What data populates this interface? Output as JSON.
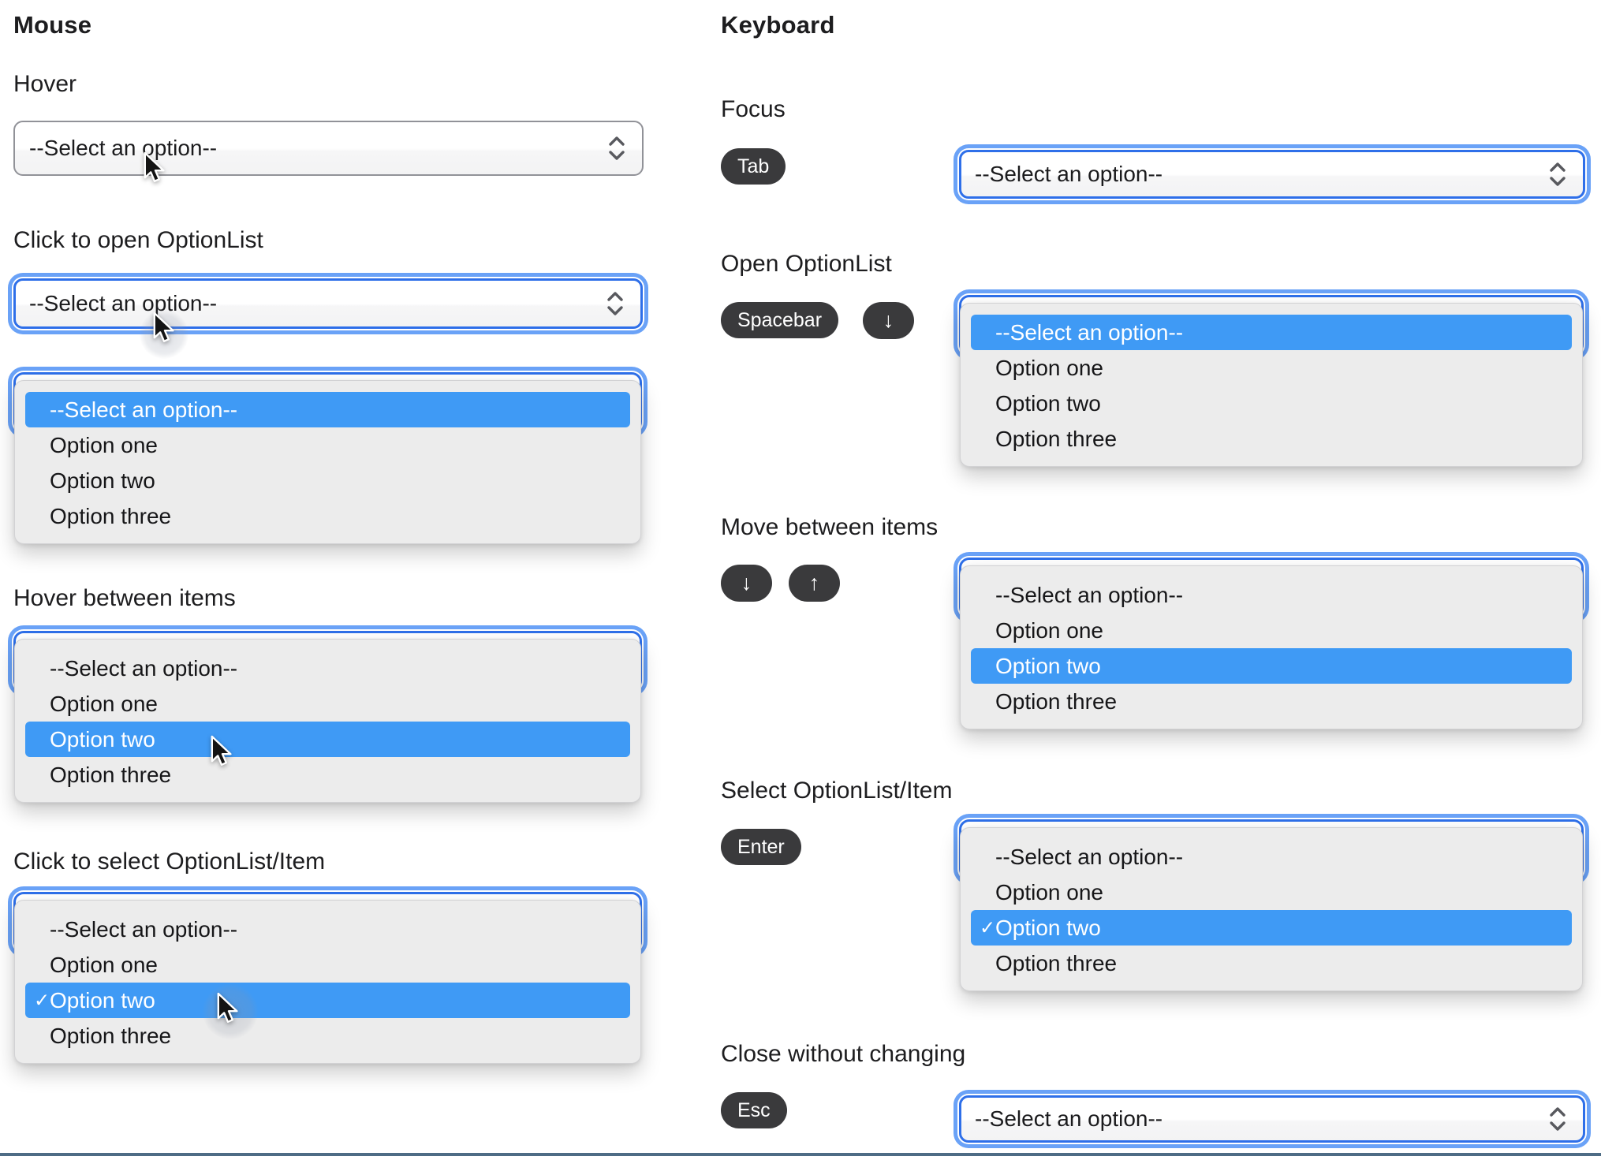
{
  "select": {
    "placeholder": "--Select an option--",
    "options": [
      "--Select an option--",
      "Option one",
      "Option two",
      "Option three"
    ],
    "checkmark": "✓"
  },
  "mouse": {
    "title": "Mouse",
    "hover_label": "Hover",
    "click_open_label": "Click to open OptionList",
    "hover_items_label": "Hover between items",
    "click_select_label": "Click to select OptionList/Item"
  },
  "keyboard": {
    "title": "Keyboard",
    "focus_label": "Focus",
    "open_label": "Open OptionList",
    "move_label": "Move between items",
    "select_label": "Select OptionList/Item",
    "close_label": "Close without changing",
    "keys": {
      "tab": "Tab",
      "spacebar": "Spacebar",
      "enter": "Enter",
      "esc": "Esc",
      "down": "↓",
      "up": "↑"
    }
  },
  "colors": {
    "highlight_blue": "#3f9af5",
    "focus_ring_inner": "#2e6fe9",
    "focus_ring_outer": "#6aa2f7",
    "key_background": "#3a3a3c",
    "panel_background": "#ececec",
    "bottom_bar": "#4e6c85"
  }
}
